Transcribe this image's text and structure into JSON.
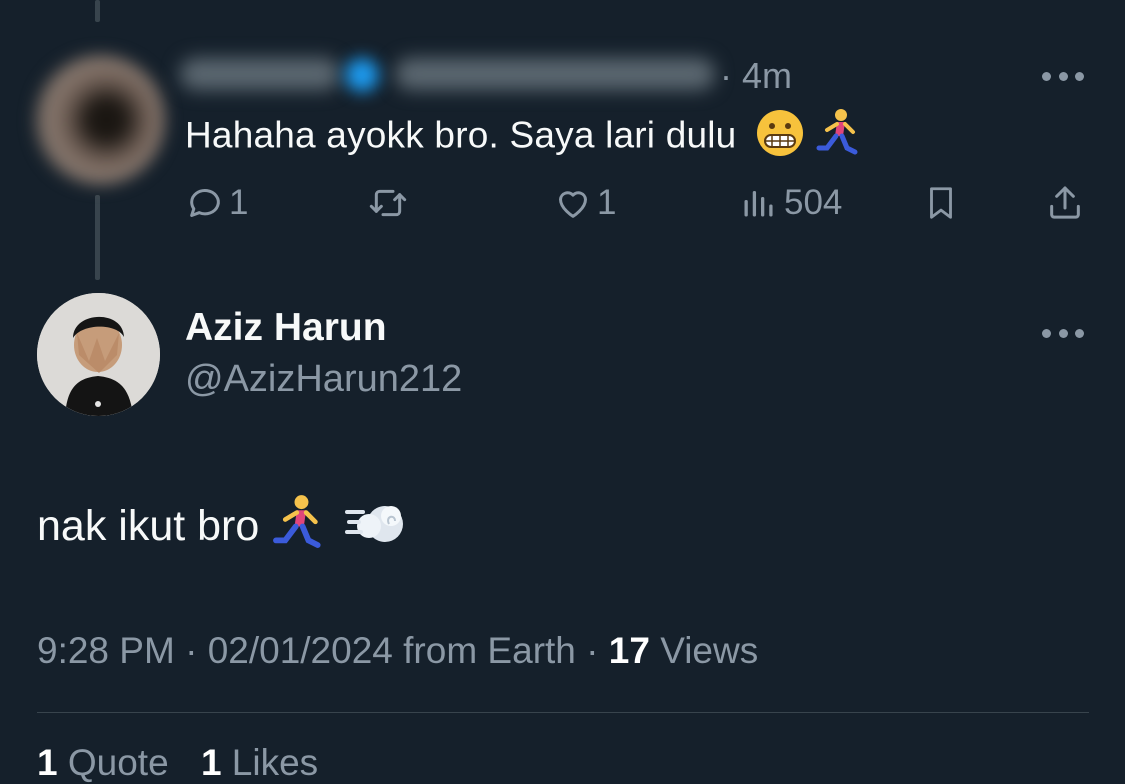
{
  "reply": {
    "timestamp": "· 4m",
    "text": "Hahaha ayokk bro. Saya lari dulu",
    "emojis": [
      "grimacing-face",
      "person-running"
    ],
    "actions": {
      "reply_count": "1",
      "retweet_count": "",
      "like_count": "1",
      "view_count": "504"
    }
  },
  "main_tweet": {
    "display_name": "Aziz Harun",
    "handle": "@AzizHarun212",
    "text": "nak ikut bro",
    "emojis": [
      "person-running",
      "dashing-away"
    ],
    "time": "9:28 PM",
    "date": "02/01/2024",
    "source": "from Earth",
    "views_count": "17",
    "views_label": "Views"
  },
  "stats": {
    "quotes_count": "1",
    "quotes_label": "Quote",
    "likes_count": "1",
    "likes_label": "Likes"
  },
  "colors": {
    "background": "#15202b",
    "text_primary": "#f7f9f9",
    "text_secondary": "#8b98a5",
    "divider": "#38444d"
  }
}
